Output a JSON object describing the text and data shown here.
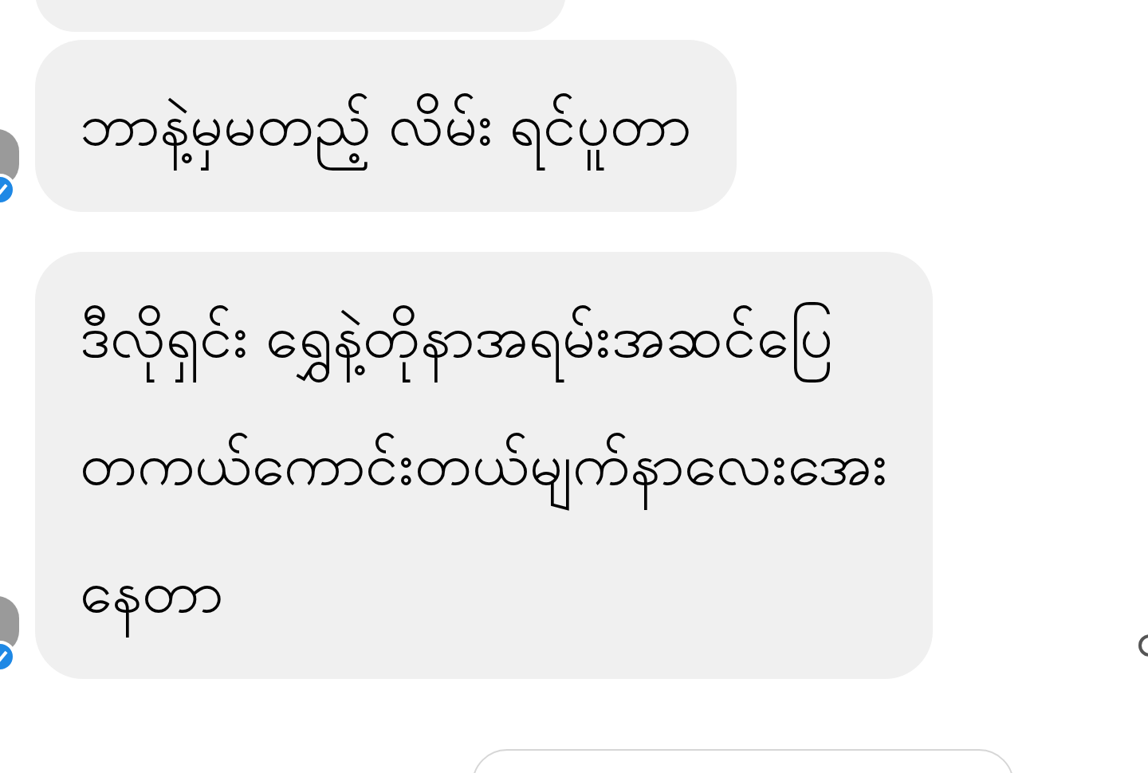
{
  "messages": [
    {
      "kind": "incoming"
    },
    {
      "kind": "incoming",
      "lines": [
        "ဘာနဲ့မှမတည့် လိမ်း ရင်ပူတာ"
      ],
      "avatar": true
    },
    {
      "kind": "incoming",
      "lines": [
        "ဒီလိုရှင်း ရွှေနဲ့တိုနာအရမ်းအဆင်ပြေ",
        "တကယ်ကောင်းတယ်မျက်နာလေးအေး",
        "နေတာ"
      ],
      "avatar": true
    },
    {
      "kind": "outgoing"
    }
  ]
}
